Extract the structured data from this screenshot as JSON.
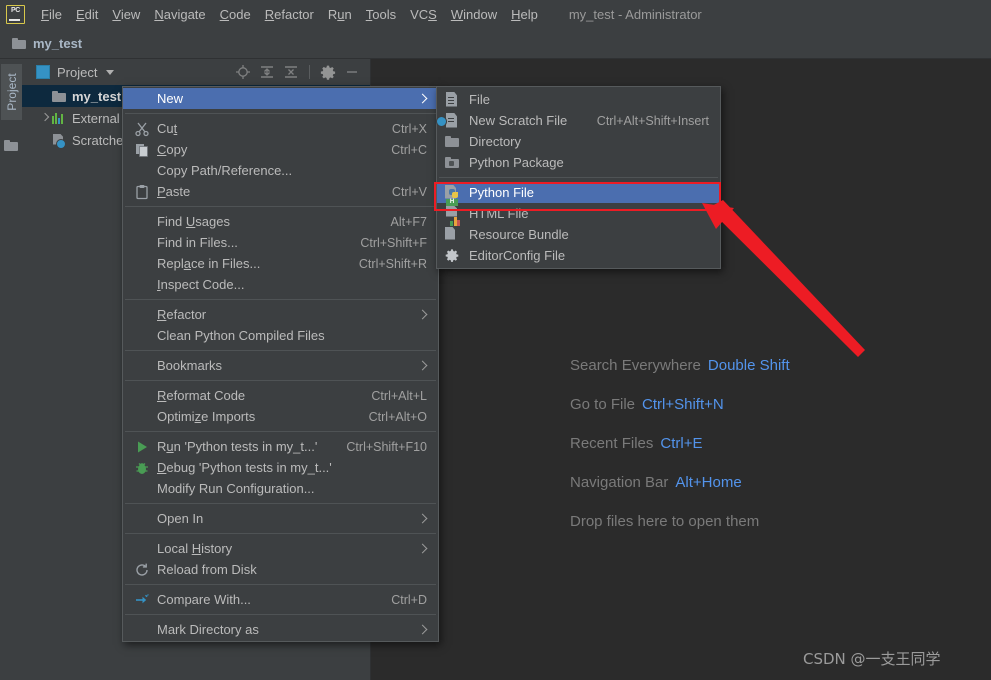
{
  "window": {
    "title": "my_test - Administrator",
    "app_logo": "pycharm-logo"
  },
  "menubar": {
    "items": [
      {
        "label": "File",
        "mnemonic": "F"
      },
      {
        "label": "Edit",
        "mnemonic": "E"
      },
      {
        "label": "View",
        "mnemonic": "V"
      },
      {
        "label": "Navigate",
        "mnemonic": "N"
      },
      {
        "label": "Code",
        "mnemonic": "C"
      },
      {
        "label": "Refactor",
        "mnemonic": "R"
      },
      {
        "label": "Run",
        "mnemonic": "u"
      },
      {
        "label": "Tools",
        "mnemonic": "T"
      },
      {
        "label": "VCS",
        "mnemonic": "S"
      },
      {
        "label": "Window",
        "mnemonic": "W"
      },
      {
        "label": "Help",
        "mnemonic": "H"
      }
    ]
  },
  "navbar": {
    "crumb": "my_test",
    "icon": "folder-icon"
  },
  "toolstrip": {
    "project_tab": "Project",
    "folder_icon": "folder-icon"
  },
  "project_panel": {
    "title": "Project",
    "tools": [
      "locate-icon",
      "expand-all-icon",
      "collapse-all-icon",
      "settings-gear-icon",
      "hide-icon"
    ],
    "tree": [
      {
        "label": "my_test",
        "icon": "folder-icon",
        "selected": true,
        "expandable": false
      },
      {
        "label": "External L",
        "icon": "library-icon",
        "selected": false,
        "expandable": true
      },
      {
        "label": "Scratches",
        "icon": "scratches-icon",
        "selected": false,
        "expandable": false
      }
    ]
  },
  "context_menu": {
    "items": [
      {
        "label": "New",
        "mnemonic": "",
        "shortcut": "",
        "icon": "",
        "submenu": true,
        "selected": true
      },
      {
        "sep": true
      },
      {
        "label": "Cut",
        "mnemonic": "t",
        "shortcut": "Ctrl+X",
        "icon": "cut-icon"
      },
      {
        "label": "Copy",
        "mnemonic": "C",
        "shortcut": "Ctrl+C",
        "icon": "copy-icon"
      },
      {
        "label": "Copy Path/Reference...",
        "mnemonic": "",
        "shortcut": "",
        "icon": ""
      },
      {
        "label": "Paste",
        "mnemonic": "P",
        "shortcut": "Ctrl+V",
        "icon": "paste-icon"
      },
      {
        "sep": true
      },
      {
        "label": "Find Usages",
        "mnemonic": "U",
        "shortcut": "Alt+F7",
        "icon": ""
      },
      {
        "label": "Find in Files...",
        "mnemonic": "",
        "shortcut": "Ctrl+Shift+F",
        "icon": ""
      },
      {
        "label": "Replace in Files...",
        "mnemonic": "a",
        "shortcut": "Ctrl+Shift+R",
        "icon": ""
      },
      {
        "label": "Inspect Code...",
        "mnemonic": "I",
        "shortcut": "",
        "icon": ""
      },
      {
        "sep": true
      },
      {
        "label": "Refactor",
        "mnemonic": "R",
        "shortcut": "",
        "icon": "",
        "submenu": true
      },
      {
        "label": "Clean Python Compiled Files",
        "mnemonic": "",
        "shortcut": "",
        "icon": ""
      },
      {
        "sep": true
      },
      {
        "label": "Bookmarks",
        "mnemonic": "",
        "shortcut": "",
        "icon": "",
        "submenu": true
      },
      {
        "sep": true
      },
      {
        "label": "Reformat Code",
        "mnemonic": "R",
        "shortcut": "Ctrl+Alt+L",
        "icon": ""
      },
      {
        "label": "Optimize Imports",
        "mnemonic": "z",
        "shortcut": "Ctrl+Alt+O",
        "icon": ""
      },
      {
        "sep": true
      },
      {
        "label": "Run 'Python tests in my_t...'",
        "mnemonic": "u",
        "shortcut": "Ctrl+Shift+F10",
        "icon": "run-icon"
      },
      {
        "label": "Debug 'Python tests in my_t...'",
        "mnemonic": "D",
        "shortcut": "",
        "icon": "debug-icon"
      },
      {
        "label": "Modify Run Configuration...",
        "mnemonic": "",
        "shortcut": "",
        "icon": ""
      },
      {
        "sep": true
      },
      {
        "label": "Open In",
        "mnemonic": "",
        "shortcut": "",
        "icon": "",
        "submenu": true
      },
      {
        "sep": true
      },
      {
        "label": "Local History",
        "mnemonic": "H",
        "shortcut": "",
        "icon": "",
        "submenu": true
      },
      {
        "label": "Reload from Disk",
        "mnemonic": "",
        "shortcut": "",
        "icon": "reload-icon"
      },
      {
        "sep": true
      },
      {
        "label": "Compare With...",
        "mnemonic": "",
        "shortcut": "Ctrl+D",
        "icon": "compare-icon"
      },
      {
        "sep": true
      },
      {
        "label": "Mark Directory as",
        "mnemonic": "",
        "shortcut": "",
        "icon": "",
        "submenu": true
      }
    ]
  },
  "submenu": {
    "items": [
      {
        "label": "File",
        "shortcut": "",
        "icon": "file-icon"
      },
      {
        "label": "New Scratch File",
        "shortcut": "Ctrl+Alt+Shift+Insert",
        "icon": "scratch-file-icon"
      },
      {
        "label": "Directory",
        "shortcut": "",
        "icon": "directory-icon"
      },
      {
        "label": "Python Package",
        "shortcut": "",
        "icon": "python-package-icon"
      },
      {
        "sep": true
      },
      {
        "label": "Python File",
        "shortcut": "",
        "icon": "python-file-icon",
        "selected": true,
        "highlighted": true
      },
      {
        "label": "HTML File",
        "shortcut": "",
        "icon": "html-file-icon"
      },
      {
        "label": "Resource Bundle",
        "shortcut": "",
        "icon": "resource-bundle-icon"
      },
      {
        "label": "EditorConfig File",
        "shortcut": "",
        "icon": "editorconfig-icon"
      }
    ]
  },
  "editor_hints": {
    "rows": [
      {
        "label": "Search Everywhere",
        "key": "Double Shift"
      },
      {
        "label": "Go to File",
        "key": "Ctrl+Shift+N"
      },
      {
        "label": "Recent Files",
        "key": "Ctrl+E"
      },
      {
        "label": "Navigation Bar",
        "key": "Alt+Home"
      },
      {
        "label": "Drop files here to open them",
        "key": ""
      }
    ]
  },
  "watermark": {
    "text": "CSDN @一支王同学"
  },
  "annotation": {
    "color": "#ed1c24",
    "highlight_target": "Python File",
    "arrow": "red-arrow-pointing-to-python-file"
  },
  "colors": {
    "chrome": "#3c3f41",
    "editor_bg": "#2b2b2b",
    "menu_bg": "#3c3f41",
    "selection_blue": "#4b6eaf",
    "tree_selection": "#0d293e",
    "link_blue": "#5394ec",
    "annotation_red": "#ed1c24"
  }
}
